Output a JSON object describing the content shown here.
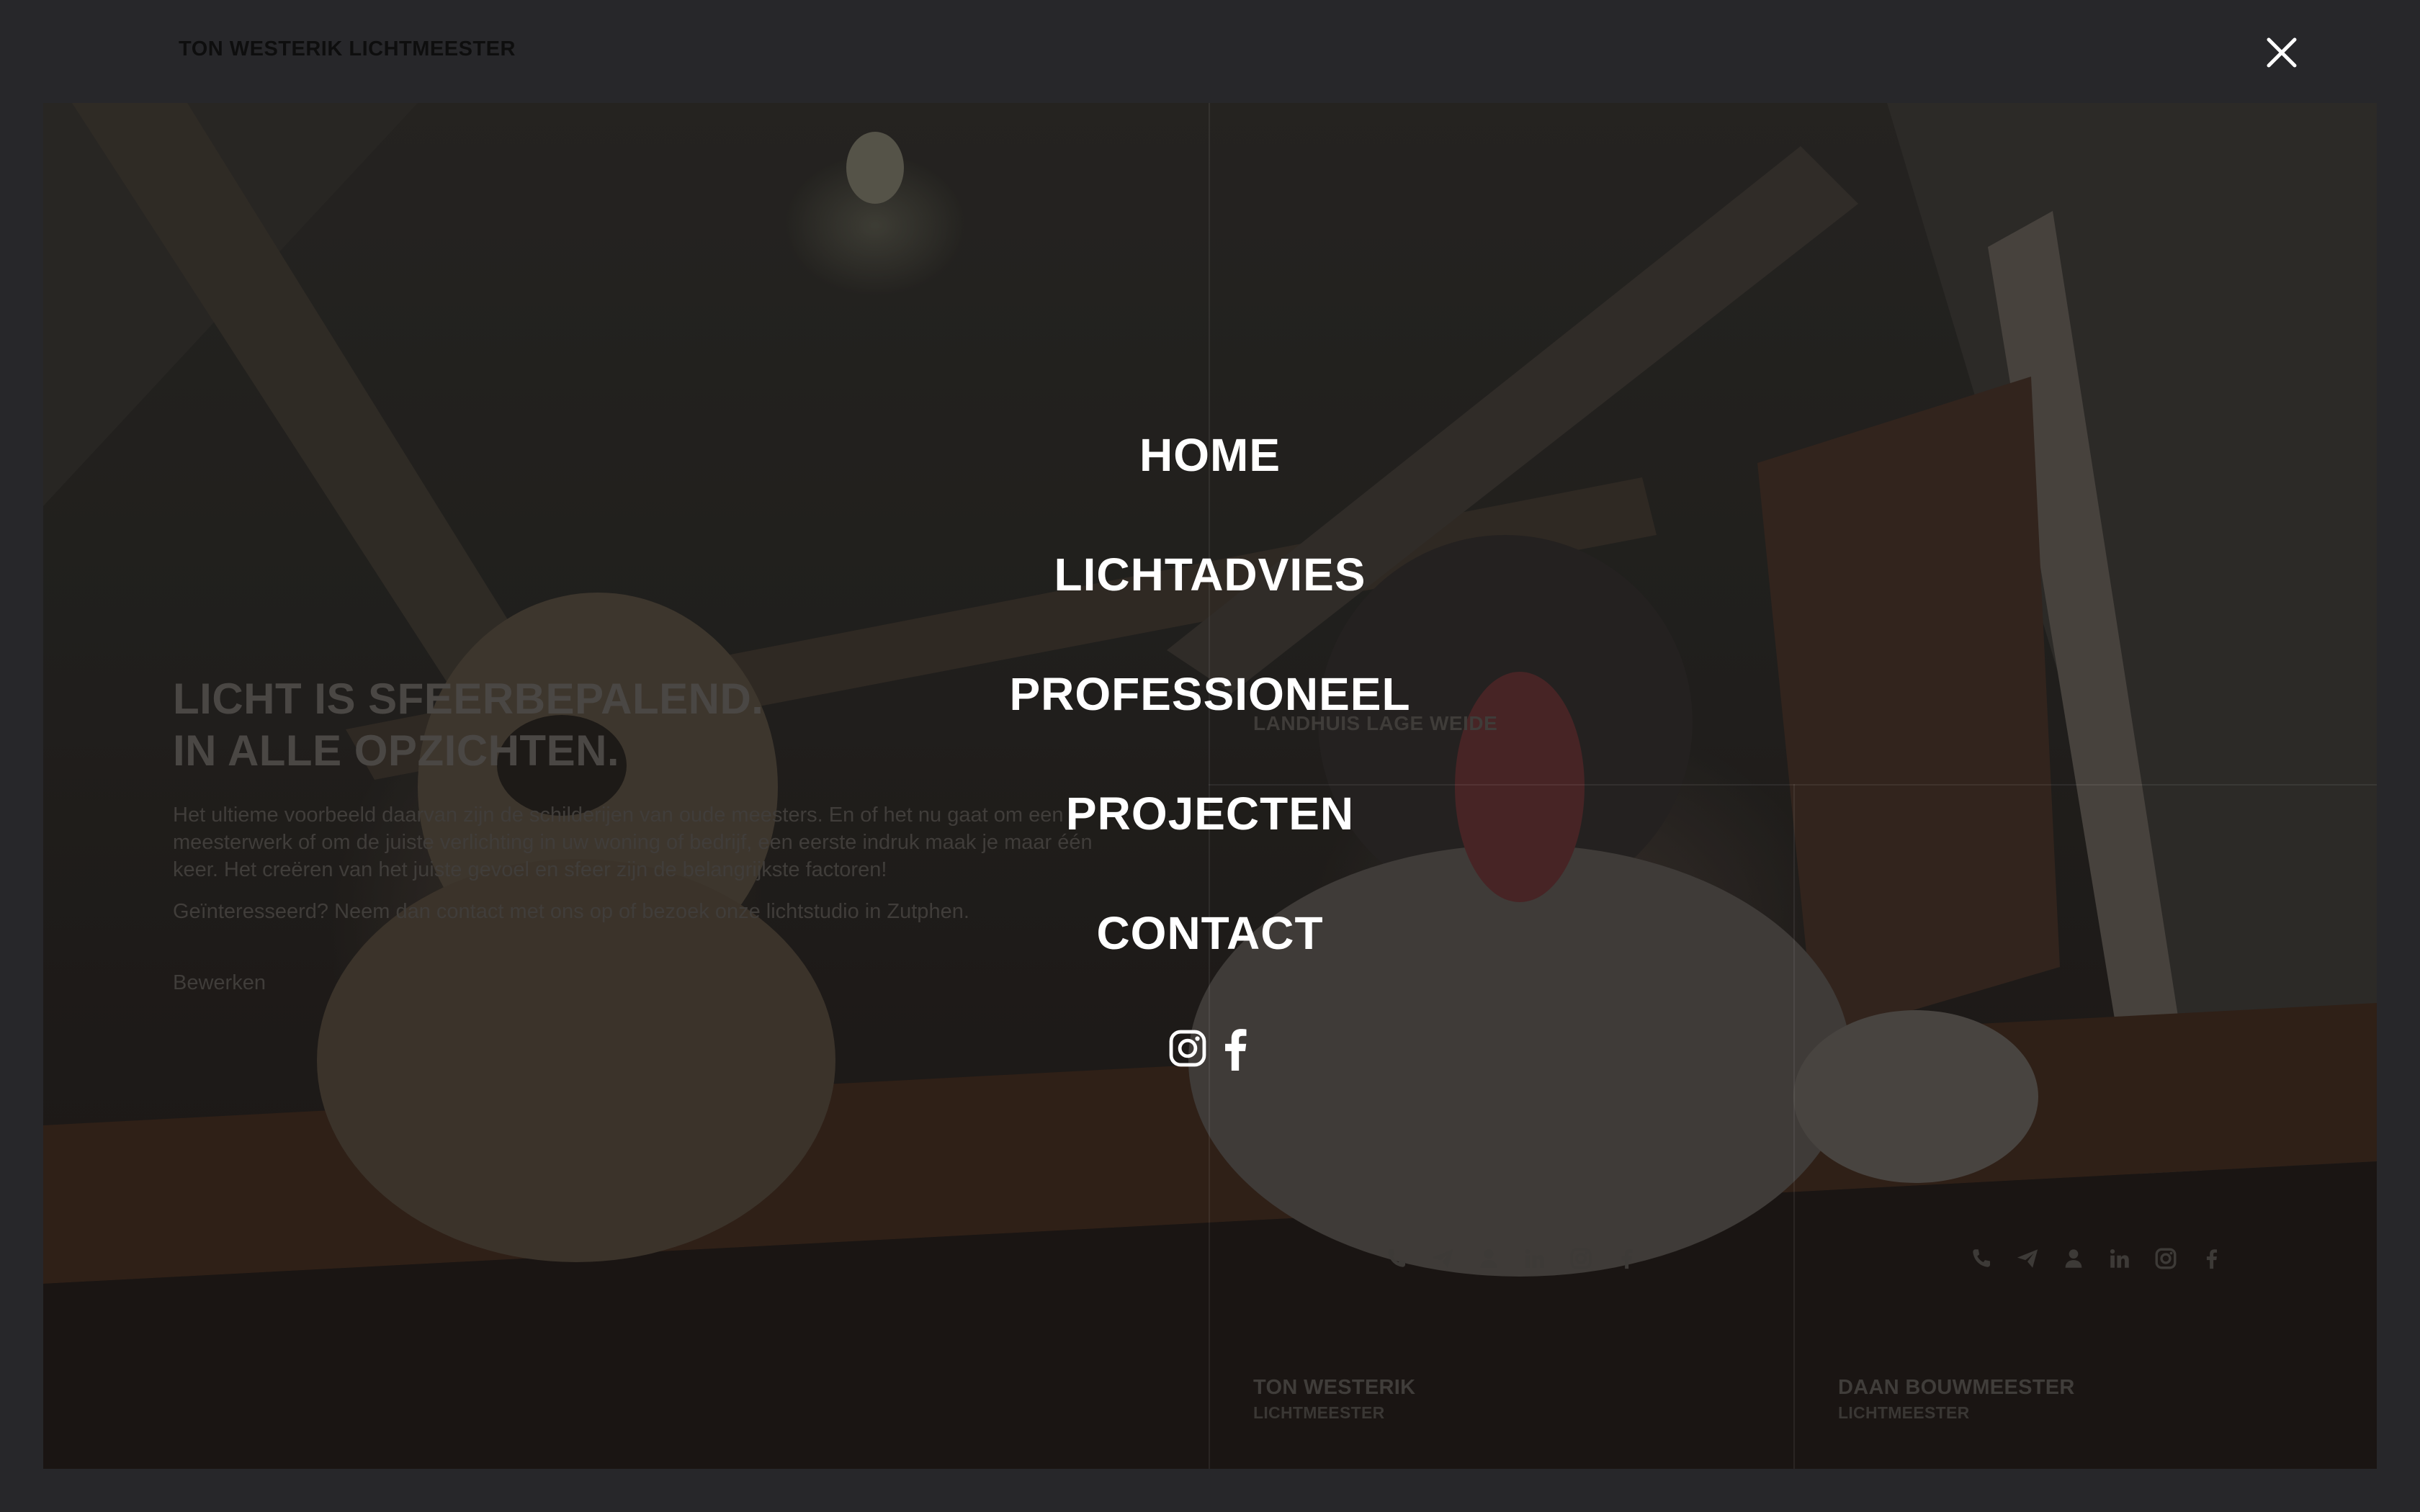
{
  "header": {
    "brand": "TON WESTERIK LICHTMEESTER",
    "close_icon": "close-icon"
  },
  "hero": {
    "title_line1": "LICHT IS SFEERBEPALEND.",
    "title_line2": "IN ALLE OPZICHTEN.",
    "paragraph1": "Het ultieme voorbeeld daarvan zijn de schilderijen van oude meesters. En of het nu gaat om een meesterwerk of om de juiste verlichting in uw woning of bedrijf, een eerste indruk maak je maar één keer. Het creëren van het juiste gevoel en sfeer zijn de belangrijkste factoren!",
    "paragraph2": "Geïnteresseerd? Neem dan contact met ons op of bezoek onze lichtstudio in Zutphen.",
    "edit_link": "Bewerken"
  },
  "project": {
    "label": "LANDHUIS LAGE WEIDE"
  },
  "people": [
    {
      "name": "TON WESTERIK",
      "role": "LICHTMEESTER",
      "icons": [
        "phone-icon",
        "send-icon",
        "user-icon",
        "linkedin-icon",
        "instagram-icon",
        "facebook-icon"
      ]
    },
    {
      "name": "DAAN BOUWMEESTER",
      "role": "LICHTMEESTER",
      "icons": [
        "phone-icon",
        "send-icon",
        "user-icon",
        "linkedin-icon",
        "instagram-icon",
        "facebook-icon"
      ]
    }
  ],
  "menu": {
    "items": [
      "HOME",
      "LICHTADVIES",
      "PROFESSIONEEL",
      "PROJECTEN",
      "CONTACT"
    ],
    "social_icons": [
      "instagram-icon",
      "facebook-icon"
    ]
  },
  "colors": {
    "background": "#27272a",
    "menu_text": "#ffffff",
    "brand_text": "#0e0e0e"
  }
}
